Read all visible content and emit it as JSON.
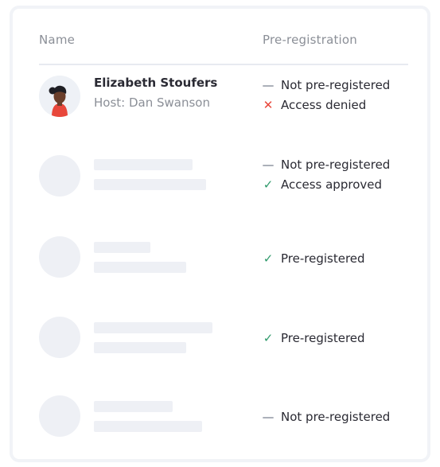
{
  "table": {
    "headers": {
      "name": "Name",
      "pre_registration": "Pre-registration"
    }
  },
  "rows": [
    {
      "name": "Elizabeth Stoufers",
      "host": "Host: Dan Swanson",
      "statuses": [
        {
          "icon": "dash-icon",
          "text": "Not pre-registered"
        },
        {
          "icon": "x-icon",
          "text": "Access denied"
        }
      ]
    },
    {
      "statuses": [
        {
          "icon": "dash-icon",
          "text": "Not pre-registered"
        },
        {
          "icon": "check-icon",
          "text": "Access approved"
        }
      ]
    },
    {
      "statuses": [
        {
          "icon": "check-icon",
          "text": "Pre-registered"
        }
      ]
    },
    {
      "statuses": [
        {
          "icon": "check-icon",
          "text": "Pre-registered"
        }
      ]
    },
    {
      "statuses": [
        {
          "icon": "dash-icon",
          "text": "Not pre-registered"
        }
      ]
    }
  ],
  "colors": {
    "text_primary": "#2a2a33",
    "text_muted": "#8b8f97",
    "skeleton": "#eef0f5",
    "denied": "#e8473b",
    "approved": "#2f9a6b",
    "dash": "#a8adb6"
  }
}
